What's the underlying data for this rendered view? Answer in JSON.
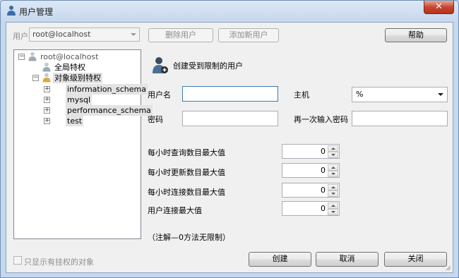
{
  "window": {
    "title": "用户管理",
    "close_glyph": "✕"
  },
  "toolbar": {
    "user_label": "用户",
    "user_select_value": "root@localhost",
    "delete_user": "删除用户",
    "add_user": "添加新用户",
    "help": "帮助"
  },
  "tree": {
    "root": "root@localhost",
    "global_privileges": "全局特权",
    "object_privileges": "对象级别特权",
    "schemas": [
      "information_schema",
      "mysql",
      "performance_schema",
      "test"
    ]
  },
  "form": {
    "heading": "创建受到限制的用户",
    "username_label": "用户名",
    "host_label": "主机",
    "host_value": "%",
    "password_label": "密码",
    "password_confirm_label": "再一次输入密码",
    "limits": [
      {
        "label": "每小时查询数目最大值",
        "value": "0"
      },
      {
        "label": "每小时更新数目最大值",
        "value": "0"
      },
      {
        "label": "每小时连接数目最大值",
        "value": "0"
      },
      {
        "label": "用户连接最大值",
        "value": "0"
      }
    ],
    "note": "（注解—0方法无限制）"
  },
  "footer": {
    "show_privileged_only": "只显示有挂权的对象",
    "create": "创建",
    "cancel": "取消",
    "close": "关闭"
  }
}
